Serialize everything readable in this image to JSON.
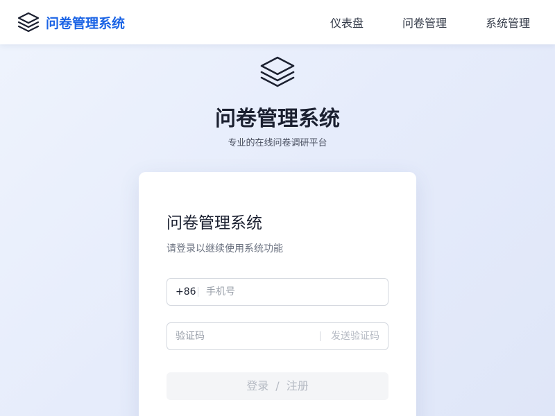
{
  "header": {
    "brand_icon": "layers-icon",
    "brand_name": "问卷管理系统",
    "brand_color": "#1a63e5",
    "nav": [
      {
        "label": "仪表盘"
      },
      {
        "label": "问卷管理"
      },
      {
        "label": "系统管理"
      }
    ]
  },
  "hero": {
    "icon": "layers-icon",
    "title": "问卷管理系统",
    "subtitle": "专业的在线问卷调研平台"
  },
  "login_card": {
    "title": "问卷管理系统",
    "subtitle": "请登录以继续使用系统功能",
    "phone": {
      "prefix": "+86",
      "placeholder": "手机号",
      "value": ""
    },
    "code": {
      "placeholder": "验证码",
      "value": "",
      "send_label": "发送验证码"
    },
    "submit": {
      "login_label": "登录",
      "separator": "/",
      "register_label": "注册",
      "disabled": true
    }
  }
}
